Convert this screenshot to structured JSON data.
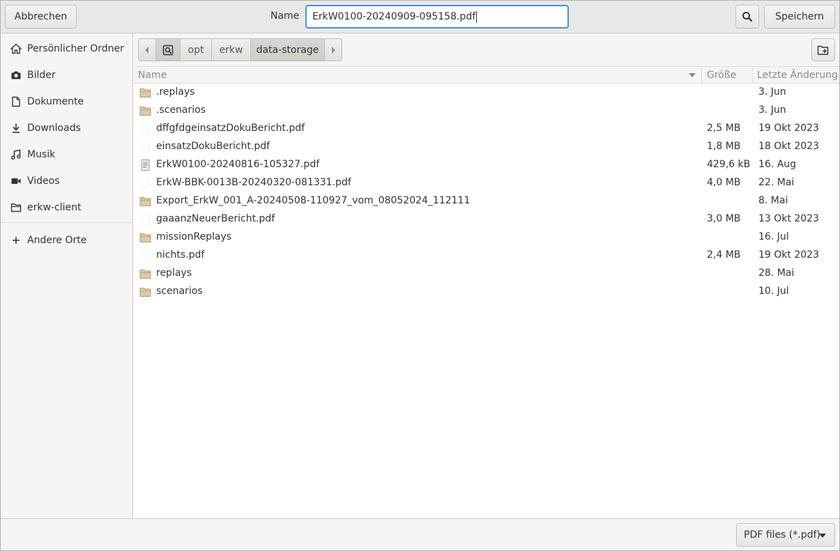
{
  "header": {
    "cancel_label": "Abbrechen",
    "name_label": "Name",
    "filename_value": "ErkW0100-20240909-095158.pdf",
    "search_icon": "search-icon",
    "save_label": "Speichern"
  },
  "sidebar": {
    "items": [
      {
        "label": "Persönlicher Ordner",
        "icon": "home-icon"
      },
      {
        "label": "Bilder",
        "icon": "camera-icon"
      },
      {
        "label": "Dokumente",
        "icon": "document-icon"
      },
      {
        "label": "Downloads",
        "icon": "download-icon"
      },
      {
        "label": "Musik",
        "icon": "music-icon"
      },
      {
        "label": "Videos",
        "icon": "video-icon"
      },
      {
        "label": "erkw-client",
        "icon": "folder-icon"
      }
    ],
    "other_places_label": "Andere Orte"
  },
  "pathbar": {
    "segments": [
      "opt",
      "erkw",
      "data-storage"
    ]
  },
  "columns": {
    "name": "Name",
    "size": "Größe",
    "modified": "Letzte Änderung"
  },
  "files": [
    {
      "name": ".replays",
      "size": "",
      "modified": "3. Jun",
      "type": "folder"
    },
    {
      "name": ".scenarios",
      "size": "",
      "modified": "3. Jun",
      "type": "folder"
    },
    {
      "name": "dffgfdgeinsatzDokuBericht.pdf",
      "size": "2,5 MB",
      "modified": "19 Okt 2023",
      "type": "file"
    },
    {
      "name": "einsatzDokuBericht.pdf",
      "size": "1,8 MB",
      "modified": "18 Okt 2023",
      "type": "file"
    },
    {
      "name": "ErkW0100-20240816-105327.pdf",
      "size": "429,6 kB",
      "modified": "16. Aug",
      "type": "pdf"
    },
    {
      "name": "ErkW-BBK-0013B-20240320-081331.pdf",
      "size": "4,0 MB",
      "modified": "22. Mai",
      "type": "file"
    },
    {
      "name": "Export_ErkW_001_A-20240508-110927_vom_08052024_112111",
      "size": "",
      "modified": "8. Mai",
      "type": "folder"
    },
    {
      "name": "gaaanzNeuerBericht.pdf",
      "size": "3,0 MB",
      "modified": "13 Okt 2023",
      "type": "file"
    },
    {
      "name": "missionReplays",
      "size": "",
      "modified": "16. Jul",
      "type": "folder"
    },
    {
      "name": "nichts.pdf",
      "size": "2,4 MB",
      "modified": "19 Okt 2023",
      "type": "file"
    },
    {
      "name": "replays",
      "size": "",
      "modified": "28. Mai",
      "type": "folder"
    },
    {
      "name": "scenarios",
      "size": "",
      "modified": "10. Jul",
      "type": "folder"
    }
  ],
  "footer": {
    "filter_label": "PDF files (*.pdf)"
  }
}
